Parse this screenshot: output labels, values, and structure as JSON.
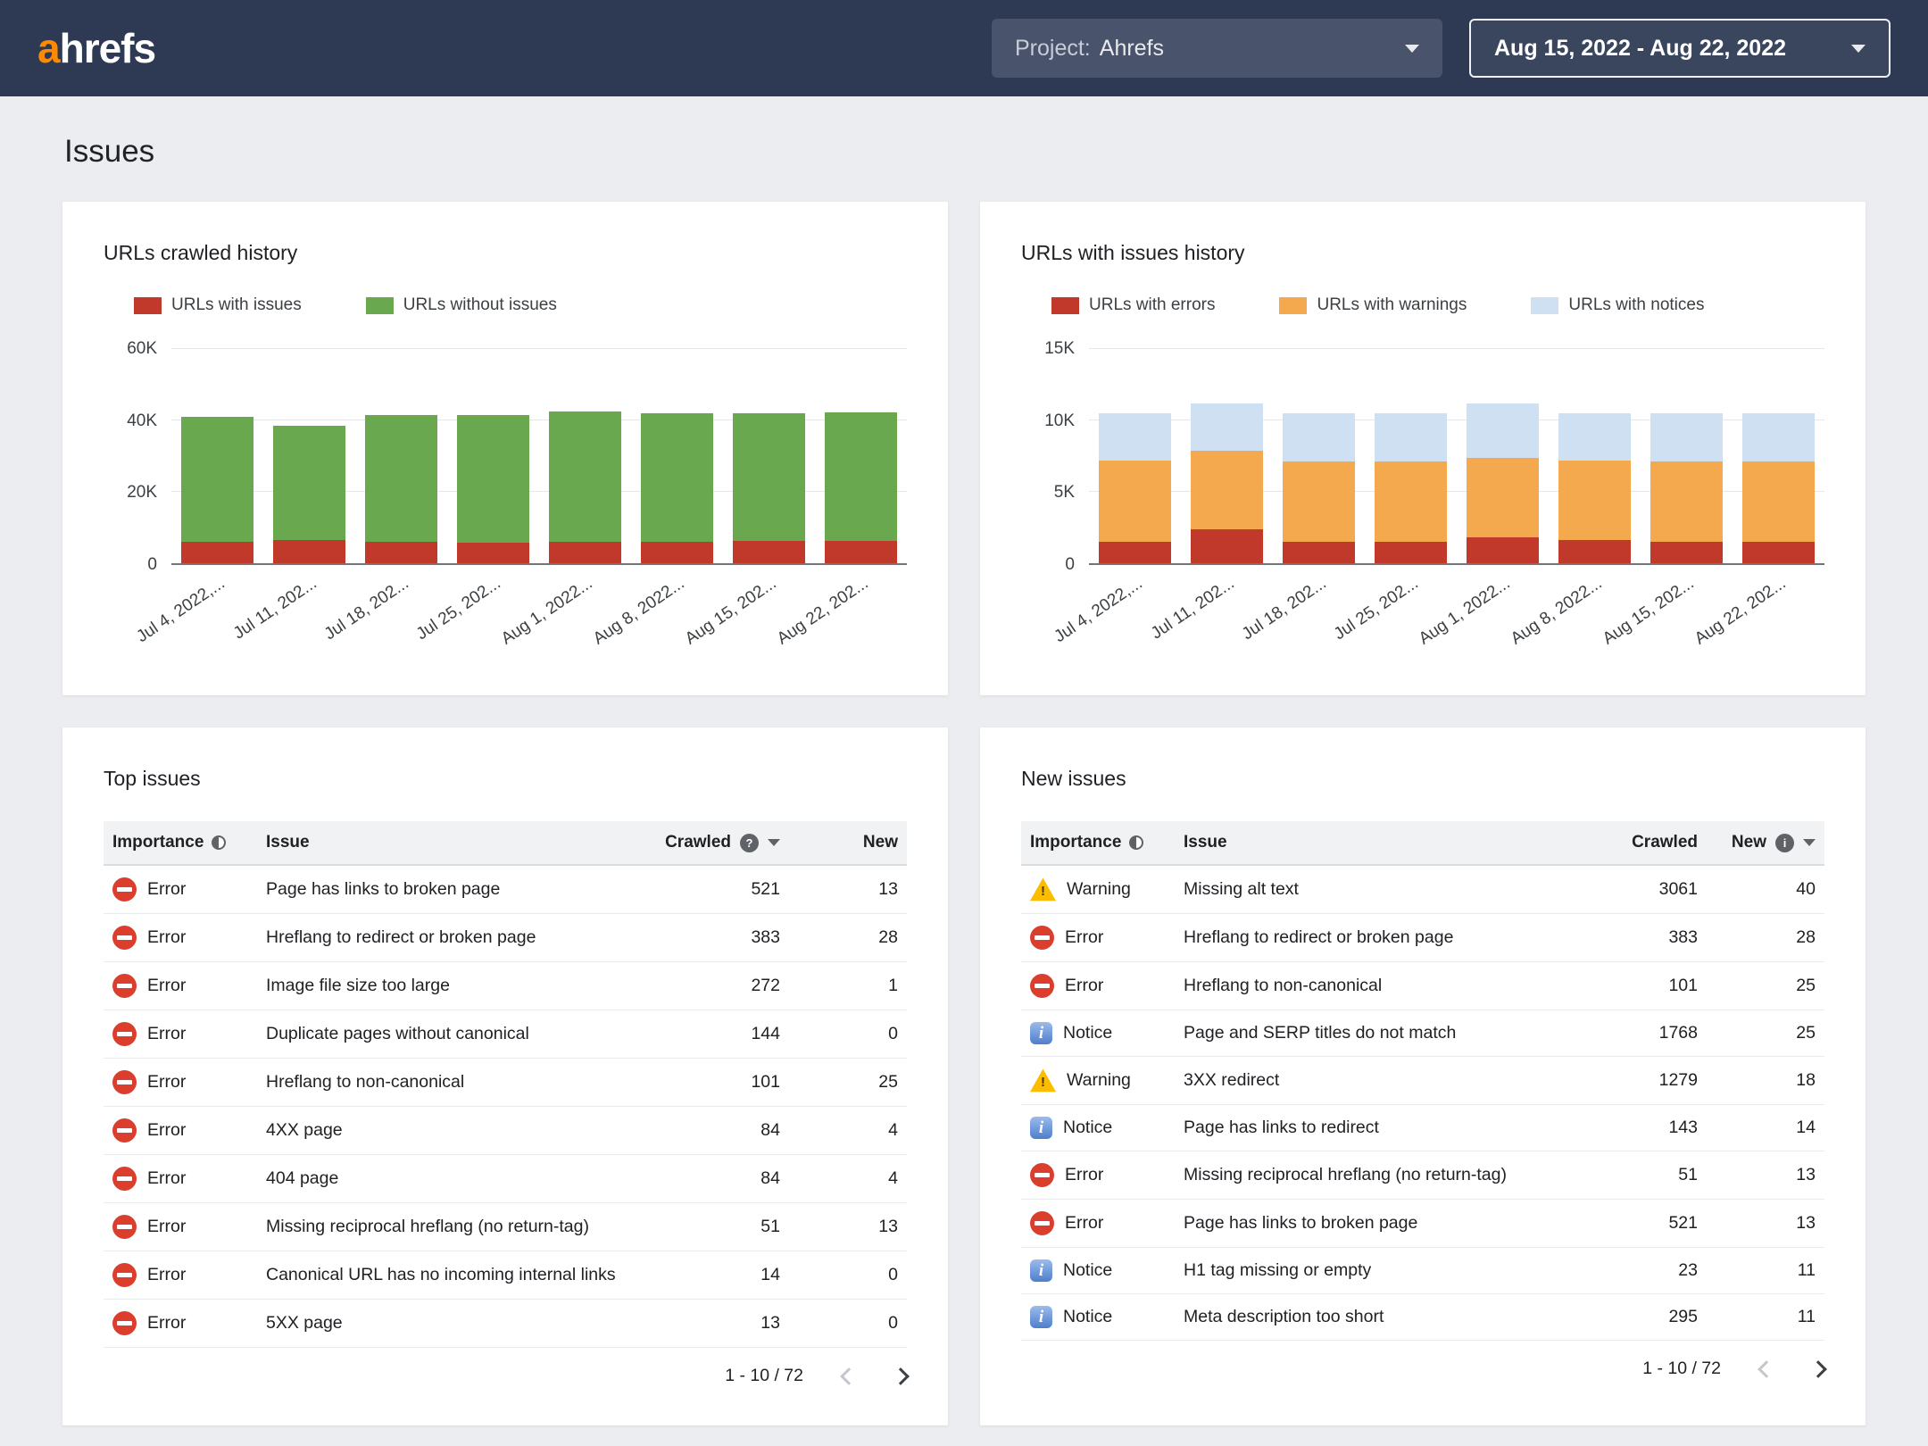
{
  "navbar": {
    "logo_orange": "a",
    "logo_white": "hrefs",
    "project_label": "Project:",
    "project_name": "Ahrefs",
    "date_range": "Aug 15, 2022 - Aug 22, 2022"
  },
  "page_title": "Issues",
  "chart_data": [
    {
      "type": "bar",
      "stacked": true,
      "title": "URLs crawled history",
      "categories": [
        "Jul 4, 2022,...",
        "Jul 11, 202...",
        "Jul 18, 202...",
        "Jul 25, 202...",
        "Aug 1, 2022...",
        "Aug 8, 2022...",
        "Aug 15, 202...",
        "Aug 22, 202..."
      ],
      "series": [
        {
          "name": "URLs with issues",
          "color": "#c0392b",
          "values": [
            6000,
            6500,
            6000,
            5800,
            6000,
            6000,
            6300,
            6300
          ]
        },
        {
          "name": "URLs without issues",
          "color": "#6aa84f",
          "values": [
            35000,
            32000,
            35500,
            35700,
            36500,
            36000,
            35700,
            36000
          ]
        }
      ],
      "ylim": [
        0,
        60000
      ],
      "yticks": [
        {
          "v": 0,
          "label": "0"
        },
        {
          "v": 20000,
          "label": "20K"
        },
        {
          "v": 40000,
          "label": "40K"
        },
        {
          "v": 60000,
          "label": "60K"
        }
      ],
      "legend_position": "top",
      "grid": true
    },
    {
      "type": "bar",
      "stacked": true,
      "title": "URLs with issues history",
      "categories": [
        "Jul 4, 2022,...",
        "Jul 11, 202...",
        "Jul 18, 202...",
        "Jul 25, 202...",
        "Aug 1, 2022...",
        "Aug 8, 2022...",
        "Aug 15, 202...",
        "Aug 22, 202..."
      ],
      "series": [
        {
          "name": "URLs with errors",
          "color": "#c0392b",
          "values": [
            1500,
            2400,
            1500,
            1500,
            1800,
            1600,
            1500,
            1500
          ]
        },
        {
          "name": "URLs with warnings",
          "color": "#f5a94f",
          "values": [
            5700,
            5500,
            5600,
            5600,
            5600,
            5600,
            5600,
            5600
          ]
        },
        {
          "name": "URLs with notices",
          "color": "#cfe0f3",
          "values": [
            3300,
            3300,
            3400,
            3400,
            3800,
            3300,
            3400,
            3400
          ]
        }
      ],
      "ylim": [
        0,
        15000
      ],
      "yticks": [
        {
          "v": 0,
          "label": "0"
        },
        {
          "v": 5000,
          "label": "5K"
        },
        {
          "v": 10000,
          "label": "10K"
        },
        {
          "v": 15000,
          "label": "15K"
        }
      ],
      "legend_position": "top",
      "grid": true
    }
  ],
  "tables": {
    "top_issues": {
      "title": "Top issues",
      "columns": [
        {
          "key": "importance",
          "label": "Importance",
          "icon": "half"
        },
        {
          "key": "issue",
          "label": "Issue"
        },
        {
          "key": "crawled",
          "label": "Crawled",
          "align": "right",
          "badge": "?",
          "caret": true
        },
        {
          "key": "new",
          "label": "New",
          "align": "right"
        }
      ],
      "rows": [
        {
          "importance": "Error",
          "issue": "Page has links to broken page",
          "crawled": "521",
          "new": "13"
        },
        {
          "importance": "Error",
          "issue": "Hreflang to redirect or broken page",
          "crawled": "383",
          "new": "28"
        },
        {
          "importance": "Error",
          "issue": "Image file size too large",
          "crawled": "272",
          "new": "1"
        },
        {
          "importance": "Error",
          "issue": "Duplicate pages without canonical",
          "crawled": "144",
          "new": "0"
        },
        {
          "importance": "Error",
          "issue": "Hreflang to non-canonical",
          "crawled": "101",
          "new": "25"
        },
        {
          "importance": "Error",
          "issue": "4XX page",
          "crawled": "84",
          "new": "4"
        },
        {
          "importance": "Error",
          "issue": "404 page",
          "crawled": "84",
          "new": "4"
        },
        {
          "importance": "Error",
          "issue": "Missing reciprocal hreflang (no return-tag)",
          "crawled": "51",
          "new": "13"
        },
        {
          "importance": "Error",
          "issue": "Canonical URL has no incoming internal links",
          "crawled": "14",
          "new": "0"
        },
        {
          "importance": "Error",
          "issue": "5XX page",
          "crawled": "13",
          "new": "0"
        }
      ],
      "pagination": "1 - 10 / 72"
    },
    "new_issues": {
      "title": "New issues",
      "columns": [
        {
          "key": "importance",
          "label": "Importance",
          "icon": "half"
        },
        {
          "key": "issue",
          "label": "Issue"
        },
        {
          "key": "crawled",
          "label": "Crawled",
          "align": "right"
        },
        {
          "key": "new",
          "label": "New",
          "align": "right",
          "badge": "i",
          "caret": true
        }
      ],
      "rows": [
        {
          "importance": "Warning",
          "issue": "Missing alt text",
          "crawled": "3061",
          "new": "40"
        },
        {
          "importance": "Error",
          "issue": "Hreflang to redirect or broken page",
          "crawled": "383",
          "new": "28"
        },
        {
          "importance": "Error",
          "issue": "Hreflang to non-canonical",
          "crawled": "101",
          "new": "25"
        },
        {
          "importance": "Notice",
          "issue": "Page and SERP titles do not match",
          "crawled": "1768",
          "new": "25"
        },
        {
          "importance": "Warning",
          "issue": "3XX redirect",
          "crawled": "1279",
          "new": "18"
        },
        {
          "importance": "Notice",
          "issue": "Page has links to redirect",
          "crawled": "143",
          "new": "14"
        },
        {
          "importance": "Error",
          "issue": "Missing reciprocal hreflang (no return-tag)",
          "crawled": "51",
          "new": "13"
        },
        {
          "importance": "Error",
          "issue": "Page has links to broken page",
          "crawled": "521",
          "new": "13"
        },
        {
          "importance": "Notice",
          "issue": "H1 tag missing or empty",
          "crawled": "23",
          "new": "11"
        },
        {
          "importance": "Notice",
          "issue": "Meta description too short",
          "crawled": "295",
          "new": "11"
        }
      ],
      "pagination": "1 - 10 / 72"
    }
  }
}
